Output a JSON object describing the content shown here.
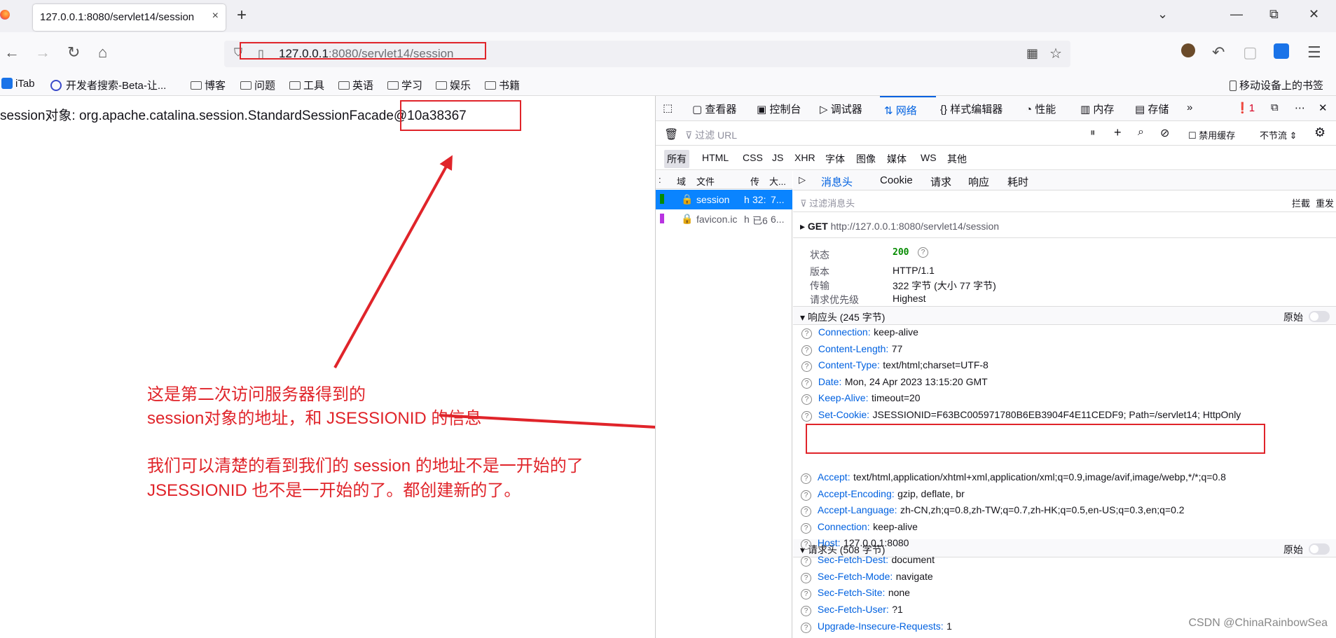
{
  "browser": {
    "tab_title": "127.0.0.1:8080/servlet14/session",
    "tab_close": "×",
    "new_tab": "+",
    "window_controls": {
      "minimize": "—",
      "restore": "⧉",
      "close": "✕",
      "list": "⌄"
    },
    "url_host": "127.0.0.1",
    "url_path": ":8080/servlet14/session",
    "bookmarks": [
      "iTab",
      "开发者搜索-Beta-让...",
      "博客",
      "问题",
      "工具",
      "英语",
      "学习",
      "娱乐",
      "书籍"
    ],
    "mobile_bookmarks": "移动设备上的书签"
  },
  "page": {
    "session_text": "session对象: org.apache.catalina.session.StandardSessionFacade@10a38367"
  },
  "annotations": {
    "line1": "这是第二次访问服务器得到的",
    "line2": "session对象的地址，和 JSESSIONID 的信息",
    "line3": "我们可以清楚的看到我们的 session 的地址不是一开始的了",
    "line4": "JSESSIONID 也不是一开始的了。都创建新的了。"
  },
  "devtools": {
    "tabs": [
      "查看器",
      "控制台",
      "调试器",
      "网络",
      "样式编辑器",
      "性能",
      "内存",
      "存储"
    ],
    "error_count": "1",
    "filter_placeholder": "过滤 URL",
    "disable_cache": "禁用缓存",
    "throttle": "不节流 ⇕",
    "type_filters": [
      "所有",
      "HTML",
      "CSS",
      "JS",
      "XHR",
      "字体",
      "图像",
      "媒体",
      "WS",
      "其他"
    ],
    "list_headers": {
      "domain": "域",
      "file": "文件",
      "transfer": "传",
      "size": "大..."
    },
    "requests": [
      {
        "file": "session",
        "type": "h",
        "transfer": "32:",
        "size": "7..."
      },
      {
        "file": "favicon.ic",
        "type": "h",
        "transfer": "已6",
        "size": "6..."
      }
    ],
    "detail_tabs": [
      "消息头",
      "Cookie",
      "请求",
      "响应",
      "耗时"
    ],
    "filter_headers_placeholder": "过滤消息头",
    "block": "拦截",
    "resend": "重发",
    "method": "GET",
    "request_url": "http://127.0.0.1:8080/servlet14/session",
    "summary": [
      {
        "label": "状态",
        "value": "200"
      },
      {
        "label": "版本",
        "value": "HTTP/1.1"
      },
      {
        "label": "传输",
        "value": "322 字节 (大小 77 字节)"
      },
      {
        "label": "请求优先级",
        "value": "Highest"
      }
    ],
    "response_section": "响应头 (245 字节)",
    "raw_label": "原始",
    "response_headers": [
      {
        "name": "Connection:",
        "value": "keep-alive"
      },
      {
        "name": "Content-Length:",
        "value": "77"
      },
      {
        "name": "Content-Type:",
        "value": "text/html;charset=UTF-8"
      },
      {
        "name": "Date:",
        "value": "Mon, 24 Apr 2023 13:15:20 GMT"
      },
      {
        "name": "Keep-Alive:",
        "value": "timeout=20"
      },
      {
        "name": "Set-Cookie:",
        "value": "JSESSIONID=F63BC005971780B6EB3904F4E11CEDF9; Path=/servlet14; HttpOnly"
      }
    ],
    "request_section": "请求头 (508 字节)",
    "request_headers": [
      {
        "name": "Accept:",
        "value": "text/html,application/xhtml+xml,application/xml;q=0.9,image/avif,image/webp,*/*;q=0.8"
      },
      {
        "name": "Accept-Encoding:",
        "value": "gzip, deflate, br"
      },
      {
        "name": "Accept-Language:",
        "value": "zh-CN,zh;q=0.8,zh-TW;q=0.7,zh-HK;q=0.5,en-US;q=0.3,en;q=0.2"
      },
      {
        "name": "Connection:",
        "value": "keep-alive"
      },
      {
        "name": "Host:",
        "value": "127.0.0.1:8080"
      },
      {
        "name": "Sec-Fetch-Dest:",
        "value": "document"
      },
      {
        "name": "Sec-Fetch-Mode:",
        "value": "navigate"
      },
      {
        "name": "Sec-Fetch-Site:",
        "value": "none"
      },
      {
        "name": "Sec-Fetch-User:",
        "value": "?1"
      },
      {
        "name": "Upgrade-Insecure-Requests:",
        "value": "1"
      }
    ]
  },
  "watermark": "CSDN @ChinaRainbowSea",
  "colors": {
    "annotation_red": "#e0242a",
    "accent_blue": "#0061e0",
    "status_green": "#058b00"
  }
}
